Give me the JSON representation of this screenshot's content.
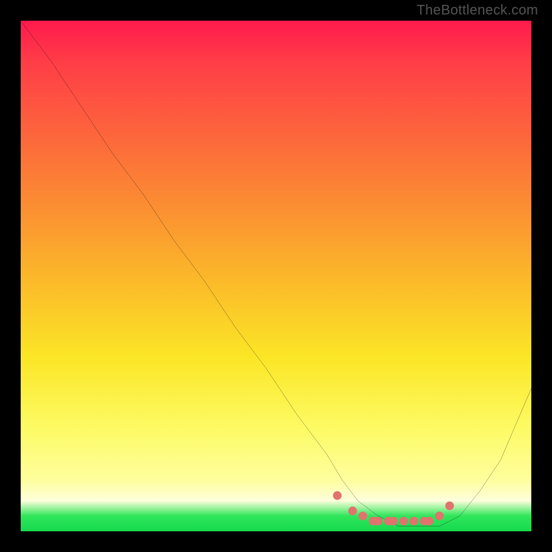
{
  "watermark": "TheBottleneck.com",
  "chart_data": {
    "type": "line",
    "title": "",
    "xlabel": "",
    "ylabel": "",
    "xlim": [
      0,
      100
    ],
    "ylim": [
      0,
      100
    ],
    "series": [
      {
        "name": "bottleneck-curve",
        "color": "#000000",
        "x": [
          0,
          6,
          12,
          18,
          24,
          30,
          36,
          42,
          48,
          54,
          60,
          63,
          66,
          70,
          74,
          78,
          82,
          86,
          90,
          94,
          100
        ],
        "values": [
          100,
          92,
          83,
          74,
          66,
          57,
          49,
          40,
          32,
          23,
          15,
          10,
          6,
          3,
          1,
          1,
          1,
          3,
          8,
          14,
          28
        ]
      },
      {
        "name": "highlight-dots",
        "color": "#e0736d",
        "x": [
          62,
          65,
          67,
          69,
          70,
          72,
          73,
          75,
          77,
          79,
          80,
          82,
          84
        ],
        "values": [
          7,
          4,
          3,
          2,
          2,
          2,
          2,
          2,
          2,
          2,
          2,
          3,
          5
        ]
      }
    ],
    "gradient_stops": [
      {
        "pos": 0,
        "color": "#ff1a4d"
      },
      {
        "pos": 8,
        "color": "#ff3d47"
      },
      {
        "pos": 20,
        "color": "#fd5f3e"
      },
      {
        "pos": 35,
        "color": "#fb8a33"
      },
      {
        "pos": 50,
        "color": "#fbb72a"
      },
      {
        "pos": 66,
        "color": "#fbe626"
      },
      {
        "pos": 80,
        "color": "#fdfb65"
      },
      {
        "pos": 90,
        "color": "#fefe9e"
      },
      {
        "pos": 94,
        "color": "#fefedc"
      },
      {
        "pos": 97,
        "color": "#2fe65a"
      },
      {
        "pos": 100,
        "color": "#16d94e"
      }
    ]
  }
}
